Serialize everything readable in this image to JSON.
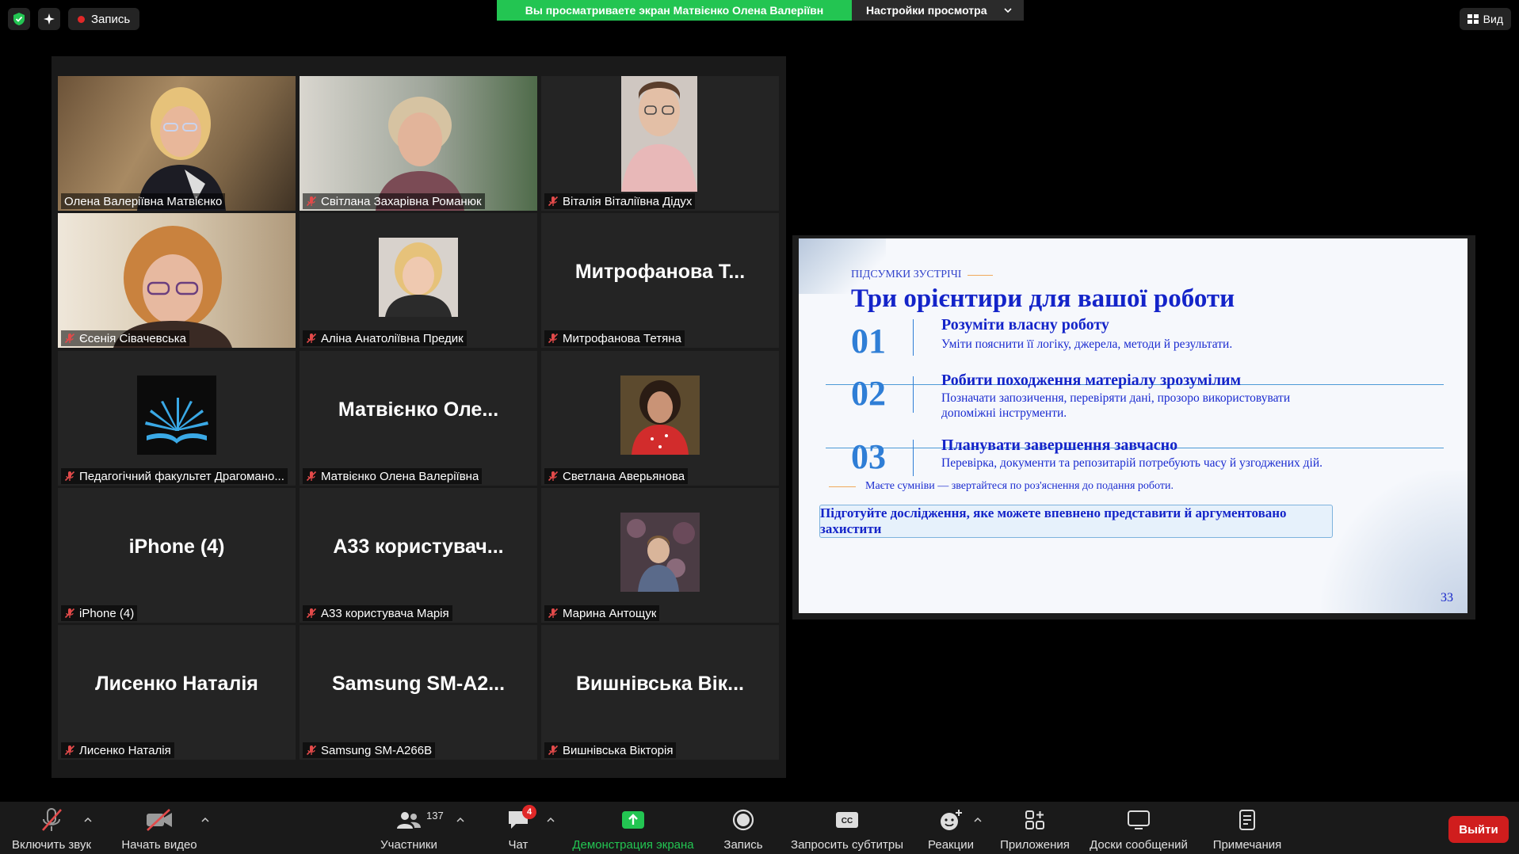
{
  "top": {
    "record_label": "Запись",
    "share_banner": "Вы просматриваете экран Матвієнко Олена Валеріївн",
    "view_settings": "Настройки просмотра",
    "view_label": "Вид"
  },
  "tiles": [
    {
      "big": "",
      "caption": "Олена Валеріївна Матвієнко",
      "muted": false
    },
    {
      "big": "",
      "caption": "Світлана Захарівна Романюк",
      "muted": true
    },
    {
      "big": "",
      "caption": "Віталія Віталіївна Дідух",
      "muted": true
    },
    {
      "big": "",
      "caption": "Єсенія Сівачевська",
      "muted": true
    },
    {
      "big": "",
      "caption": "Аліна Анатоліївна Предик",
      "muted": true
    },
    {
      "big": "Митрофанова Т...",
      "caption": "Митрофанова Тетяна",
      "muted": true
    },
    {
      "big": "",
      "caption": "Педагогічний факультет Драгомано...",
      "muted": true
    },
    {
      "big": "Матвієнко Оле...",
      "caption": "Матвієнко Олена Валеріївна",
      "muted": true
    },
    {
      "big": "",
      "caption": "Светлана Аверьянова",
      "muted": true
    },
    {
      "big": "iPhone (4)",
      "caption": "iPhone (4)",
      "muted": true
    },
    {
      "big": "A33  користувач...",
      "caption": "A33 користувача Марія",
      "muted": true
    },
    {
      "big": "",
      "caption": "Марина Антощук",
      "muted": true
    },
    {
      "big": "Лисенко Наталія",
      "caption": "Лисенко Наталія",
      "muted": true
    },
    {
      "big": "Samsung  SM-A2...",
      "caption": "Samsung SM-A266B",
      "muted": true
    },
    {
      "big": "Вишнівська Вік...",
      "caption": "Вишнівська Вікторія",
      "muted": true
    }
  ],
  "slide": {
    "kicker": "ПІДСУМКИ ЗУСТРІЧІ",
    "title": "Три орієнтири для вашої роботи",
    "items": [
      {
        "num": "01",
        "head": "Розуміти власну роботу",
        "sub": "Уміти пояснити її логіку, джерела, методи й результати."
      },
      {
        "num": "02",
        "head": "Робити походження матеріалу зрозумілим",
        "sub": "Позначати запозичення, перевіряти дані, прозоро використовувати допоміжні інструменти."
      },
      {
        "num": "03",
        "head": "Планувати завершення завчасно",
        "sub": "Перевірка, документи та репозитарій потребують часу й узгоджених дій."
      }
    ],
    "note": "Маєте сумніви — звертайтеся по роз'яснення до подання роботи.",
    "callout": "Підготуйте дослідження, яке можете впевнено представити й аргументовано захистити",
    "page": "33"
  },
  "toolbar": {
    "mute": "Включить звук",
    "video": "Начать видео",
    "participants": "Участники",
    "participants_count": "137",
    "chat": "Чат",
    "chat_badge": "4",
    "share": "Демонстрация экрана",
    "record": "Запись",
    "captions": "Запросить субтитры",
    "reactions": "Реакции",
    "apps": "Приложения",
    "whiteboards": "Доски сообщений",
    "notes": "Примечания",
    "exit": "Выйти"
  },
  "colors": {
    "accent_green": "#23c552",
    "exit_red": "#d01d1d",
    "active_speaker": "#e2e36a",
    "slide_blue": "#1424c9"
  }
}
